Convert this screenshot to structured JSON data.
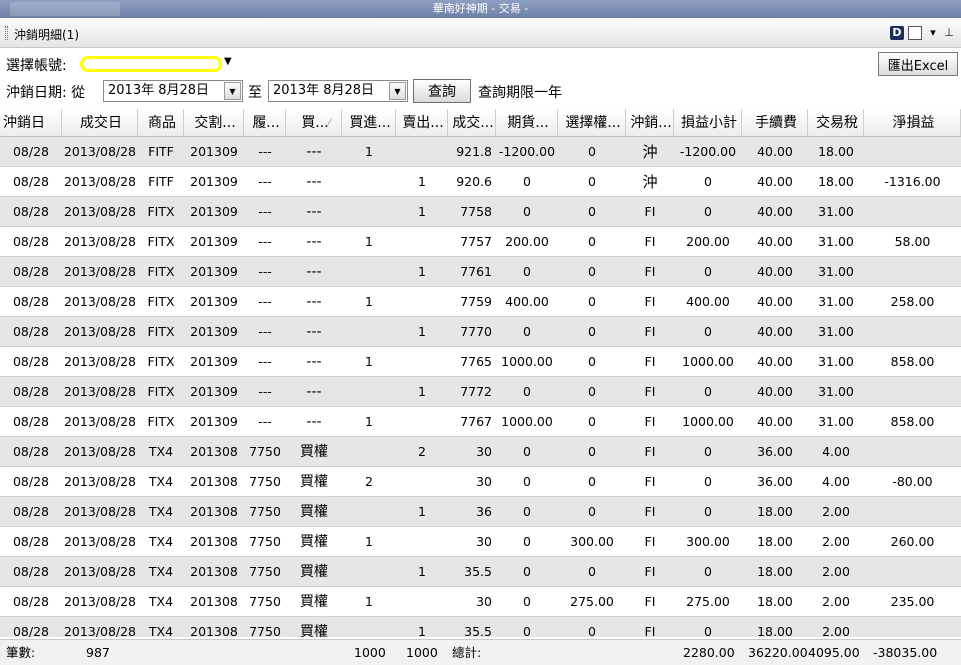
{
  "window": {
    "title": "華南好神期 - 交易 -"
  },
  "panel": {
    "title": "沖銷明細(1)",
    "d_icon": "D"
  },
  "toolbar": {
    "export_label": "匯出Excel",
    "account_label": "選擇帳號:",
    "date_label": "沖銷日期: 從",
    "date_from": "2013年  8月28日",
    "to_label": "至",
    "date_to": "2013年  8月28日",
    "query_label": "查詢",
    "query_note": "查詢期限一年"
  },
  "icons": [
    "d-icon",
    "window-icon",
    "dropdown-icon",
    "pin-icon",
    "chevron-down-icon",
    "sort-icon"
  ],
  "table": {
    "headers": [
      "沖銷日",
      "成交日",
      "商品",
      "交割...",
      "履...",
      "買...",
      "買進...",
      "賣出...",
      "成交...",
      "期貨...",
      "選擇權...",
      "沖銷...",
      "損益小計",
      "手續費",
      "交易稅",
      "淨損益"
    ],
    "rows": [
      [
        "08/28",
        "2013/08/28",
        "FITF",
        "201309",
        "---",
        "---",
        "1",
        "",
        "921.8",
        "-1200.00",
        "0",
        "沖",
        "-1200.00",
        "40.00",
        "18.00",
        ""
      ],
      [
        "08/28",
        "2013/08/28",
        "FITF",
        "201309",
        "---",
        "---",
        "",
        "1",
        "920.6",
        "0",
        "0",
        "沖",
        "0",
        "40.00",
        "18.00",
        "-1316.00"
      ],
      [
        "08/28",
        "2013/08/28",
        "FITX",
        "201309",
        "---",
        "---",
        "",
        "1",
        "7758",
        "0",
        "0",
        "FI",
        "0",
        "40.00",
        "31.00",
        ""
      ],
      [
        "08/28",
        "2013/08/28",
        "FITX",
        "201309",
        "---",
        "---",
        "1",
        "",
        "7757",
        "200.00",
        "0",
        "FI",
        "200.00",
        "40.00",
        "31.00",
        "58.00"
      ],
      [
        "08/28",
        "2013/08/28",
        "FITX",
        "201309",
        "---",
        "---",
        "",
        "1",
        "7761",
        "0",
        "0",
        "FI",
        "0",
        "40.00",
        "31.00",
        ""
      ],
      [
        "08/28",
        "2013/08/28",
        "FITX",
        "201309",
        "---",
        "---",
        "1",
        "",
        "7759",
        "400.00",
        "0",
        "FI",
        "400.00",
        "40.00",
        "31.00",
        "258.00"
      ],
      [
        "08/28",
        "2013/08/28",
        "FITX",
        "201309",
        "---",
        "---",
        "",
        "1",
        "7770",
        "0",
        "0",
        "FI",
        "0",
        "40.00",
        "31.00",
        ""
      ],
      [
        "08/28",
        "2013/08/28",
        "FITX",
        "201309",
        "---",
        "---",
        "1",
        "",
        "7765",
        "1000.00",
        "0",
        "FI",
        "1000.00",
        "40.00",
        "31.00",
        "858.00"
      ],
      [
        "08/28",
        "2013/08/28",
        "FITX",
        "201309",
        "---",
        "---",
        "",
        "1",
        "7772",
        "0",
        "0",
        "FI",
        "0",
        "40.00",
        "31.00",
        ""
      ],
      [
        "08/28",
        "2013/08/28",
        "FITX",
        "201309",
        "---",
        "---",
        "1",
        "",
        "7767",
        "1000.00",
        "0",
        "FI",
        "1000.00",
        "40.00",
        "31.00",
        "858.00"
      ],
      [
        "08/28",
        "2013/08/28",
        "TX4",
        "201308",
        "7750",
        "買權",
        "",
        "2",
        "30",
        "0",
        "0",
        "FI",
        "0",
        "36.00",
        "4.00",
        ""
      ],
      [
        "08/28",
        "2013/08/28",
        "TX4",
        "201308",
        "7750",
        "買權",
        "2",
        "",
        "30",
        "0",
        "0",
        "FI",
        "0",
        "36.00",
        "4.00",
        "-80.00"
      ],
      [
        "08/28",
        "2013/08/28",
        "TX4",
        "201308",
        "7750",
        "買權",
        "",
        "1",
        "36",
        "0",
        "0",
        "FI",
        "0",
        "18.00",
        "2.00",
        ""
      ],
      [
        "08/28",
        "2013/08/28",
        "TX4",
        "201308",
        "7750",
        "買權",
        "1",
        "",
        "30",
        "0",
        "300.00",
        "FI",
        "300.00",
        "18.00",
        "2.00",
        "260.00"
      ],
      [
        "08/28",
        "2013/08/28",
        "TX4",
        "201308",
        "7750",
        "買權",
        "",
        "1",
        "35.5",
        "0",
        "0",
        "FI",
        "0",
        "18.00",
        "2.00",
        ""
      ],
      [
        "08/28",
        "2013/08/28",
        "TX4",
        "201308",
        "7750",
        "買權",
        "1",
        "",
        "30",
        "0",
        "275.00",
        "FI",
        "275.00",
        "18.00",
        "2.00",
        "235.00"
      ],
      [
        "08/28",
        "2013/08/28",
        "TX4",
        "201308",
        "7750",
        "買權",
        "",
        "1",
        "35.5",
        "0",
        "0",
        "FI",
        "0",
        "18.00",
        "2.00",
        ""
      ]
    ]
  },
  "footer": {
    "count_label": "筆數:",
    "count_value": "987",
    "buy_total": "1000",
    "sell_total": "1000",
    "total_label": "總計:",
    "pnl_total": "2280.00",
    "fee_total": "36220.00",
    "tax_total": "4095.00",
    "net_total": "-38035.00"
  }
}
